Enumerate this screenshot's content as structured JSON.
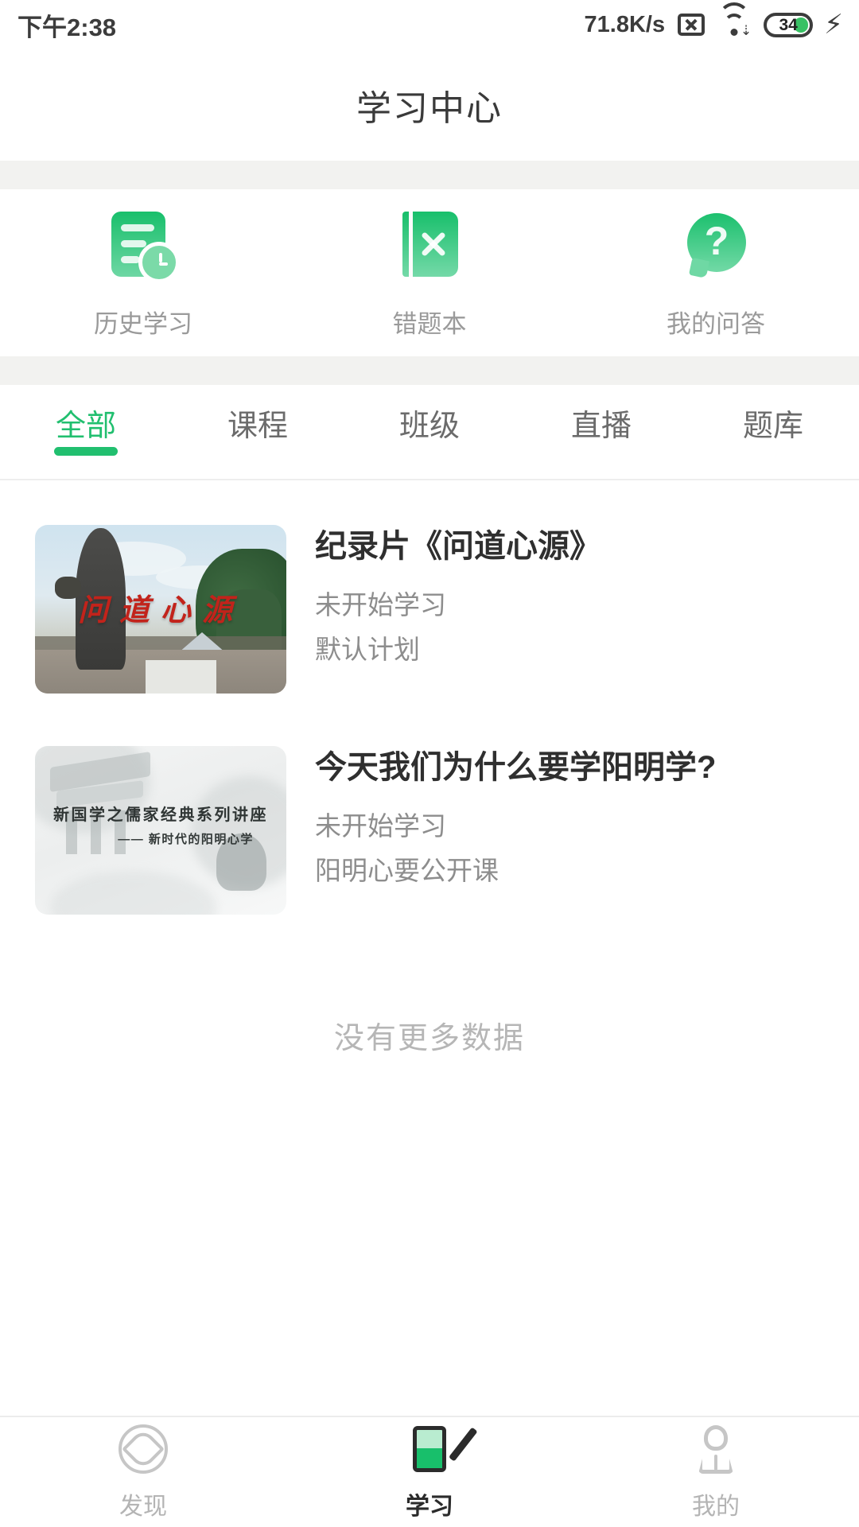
{
  "theme": {
    "accent": "#21bf6f",
    "accent_dark": "#18bf6b",
    "text_primary": "#2f2f2f",
    "text_muted": "#8d8d8d",
    "divider": "#f2f2f0"
  },
  "status_bar": {
    "time": "下午2:38",
    "net_speed": "71.8K/s",
    "battery_level": "34",
    "icons": [
      "x-box-icon",
      "wifi-icon",
      "battery-icon",
      "charging-bolt-icon"
    ]
  },
  "header": {
    "title": "学习中心"
  },
  "quick_actions": [
    {
      "label": "历史学习",
      "icon": "history-document-clock-icon"
    },
    {
      "label": "错题本",
      "icon": "wrong-question-book-icon"
    },
    {
      "label": "我的问答",
      "icon": "question-bubble-icon"
    }
  ],
  "tabs": {
    "active_index": 0,
    "items": [
      {
        "label": "全部"
      },
      {
        "label": "课程"
      },
      {
        "label": "班级"
      },
      {
        "label": "直播"
      },
      {
        "label": "题库"
      }
    ]
  },
  "list": {
    "items": [
      {
        "title": "纪录片《问道心源》",
        "status": "未开始学习",
        "plan": "默认计划",
        "thumb_caption": "问道心源"
      },
      {
        "title": "今天我们为什么要学阳明学?",
        "status": "未开始学习",
        "plan": "阳明心要公开课",
        "thumb_caption": "新国学之儒家经典系列讲座",
        "thumb_subcaption": "—— 新时代的阳明心学"
      }
    ],
    "footer": "没有更多数据"
  },
  "bottom_nav": {
    "active_index": 1,
    "items": [
      {
        "label": "发现",
        "icon": "compass-icon"
      },
      {
        "label": "学习",
        "icon": "study-phone-pen-icon"
      },
      {
        "label": "我的",
        "icon": "person-icon"
      }
    ]
  }
}
